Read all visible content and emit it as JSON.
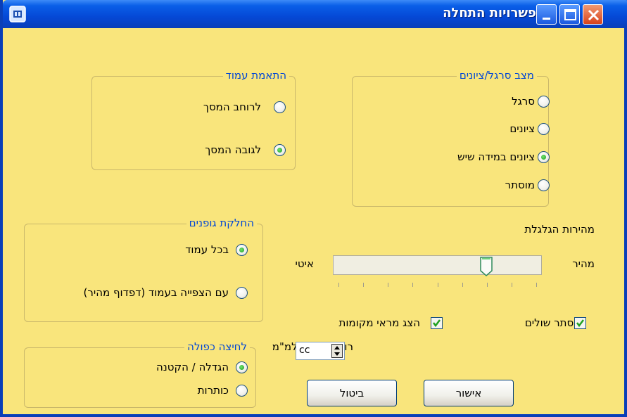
{
  "window": {
    "title": "אפשרויות התחלה"
  },
  "group_ruler": {
    "legend": "מצב סרגל/ציונים",
    "options": [
      {
        "label": "סרגל",
        "selected": false
      },
      {
        "label": "ציונים",
        "selected": false
      },
      {
        "label": "ציונים במידה שיש",
        "selected": true
      },
      {
        "label": "מוסתר",
        "selected": false
      }
    ]
  },
  "group_fit": {
    "legend": "התאמת עמוד",
    "options": [
      {
        "label": "לרוחב המסך",
        "selected": false
      },
      {
        "label": "לגובה המסך",
        "selected": true
      }
    ]
  },
  "group_fonts": {
    "legend": "החלקת גופנים",
    "options": [
      {
        "label": "בכל עמוד",
        "selected": true
      },
      {
        "label": "עם הצפייה בעמוד (דפדוף מהיר)",
        "selected": false
      }
    ]
  },
  "group_double_click": {
    "legend": "לחיצה כפולה",
    "options": [
      {
        "label": "הגדלה / הקטנה",
        "selected": true
      },
      {
        "label": "כותרות",
        "selected": false
      }
    ]
  },
  "scroll_speed": {
    "label": "מהירות הגלגלת",
    "fast_label": "מהיר",
    "slow_label": "איטי",
    "position": 0.75
  },
  "checkboxes": {
    "hide_margins": {
      "label": "הסתר שולים",
      "checked": true
    },
    "show_sources": {
      "label": "הצג מראי מקומות",
      "checked": true
    }
  },
  "display_width": {
    "label": "רוחב תצוגה למ\"מ",
    "value": "cc",
    "unit": "%"
  },
  "buttons": {
    "ok": "אישור",
    "cancel": "ביטול"
  },
  "colors": {
    "dialog_bg": "#f9e57c",
    "title_bar": "#0548d6",
    "legend_text": "#0046d5"
  }
}
